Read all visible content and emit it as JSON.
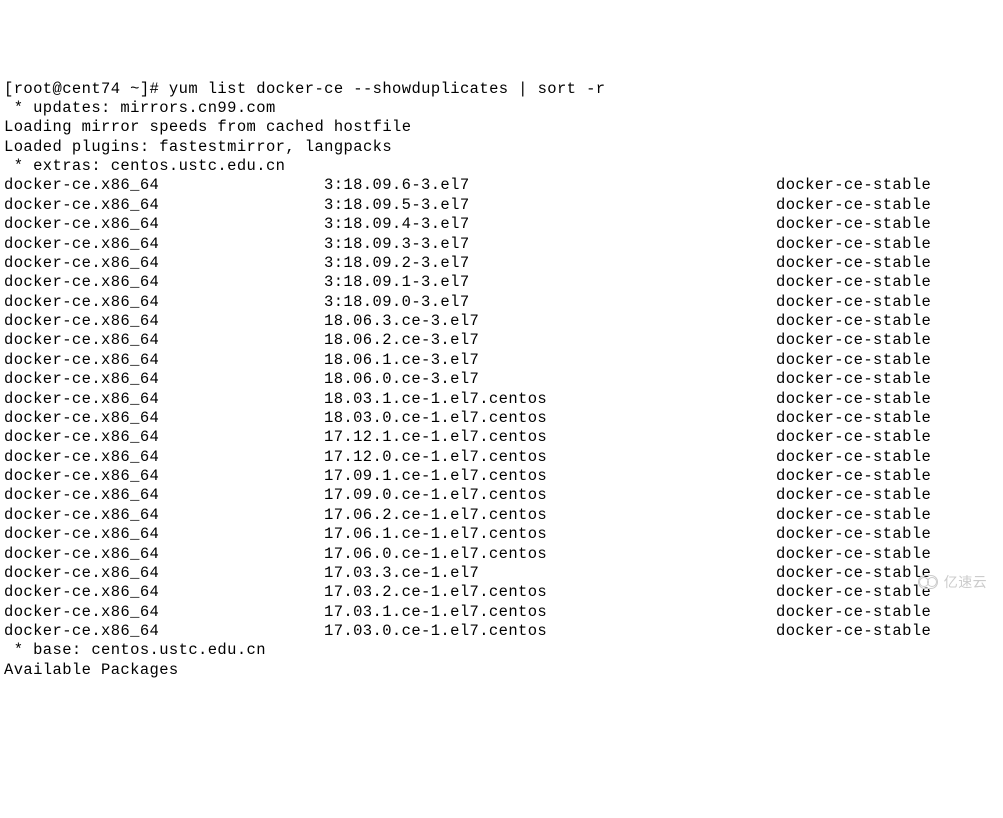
{
  "prompt": "[root@cent74 ~]# yum list docker-ce --showduplicates | sort -r",
  "header_lines": [
    " * updates: mirrors.cn99.com",
    "Loading mirror speeds from cached hostfile",
    "Loaded plugins: fastestmirror, langpacks",
    " * extras: centos.ustc.edu.cn"
  ],
  "packages": [
    {
      "name": "docker-ce.x86_64",
      "version": "3:18.09.6-3.el7",
      "repo": "docker-ce-stable"
    },
    {
      "name": "docker-ce.x86_64",
      "version": "3:18.09.5-3.el7",
      "repo": "docker-ce-stable"
    },
    {
      "name": "docker-ce.x86_64",
      "version": "3:18.09.4-3.el7",
      "repo": "docker-ce-stable"
    },
    {
      "name": "docker-ce.x86_64",
      "version": "3:18.09.3-3.el7",
      "repo": "docker-ce-stable"
    },
    {
      "name": "docker-ce.x86_64",
      "version": "3:18.09.2-3.el7",
      "repo": "docker-ce-stable"
    },
    {
      "name": "docker-ce.x86_64",
      "version": "3:18.09.1-3.el7",
      "repo": "docker-ce-stable"
    },
    {
      "name": "docker-ce.x86_64",
      "version": "3:18.09.0-3.el7",
      "repo": "docker-ce-stable"
    },
    {
      "name": "docker-ce.x86_64",
      "version": "18.06.3.ce-3.el7",
      "repo": "docker-ce-stable"
    },
    {
      "name": "docker-ce.x86_64",
      "version": "18.06.2.ce-3.el7",
      "repo": "docker-ce-stable"
    },
    {
      "name": "docker-ce.x86_64",
      "version": "18.06.1.ce-3.el7",
      "repo": "docker-ce-stable"
    },
    {
      "name": "docker-ce.x86_64",
      "version": "18.06.0.ce-3.el7",
      "repo": "docker-ce-stable"
    },
    {
      "name": "docker-ce.x86_64",
      "version": "18.03.1.ce-1.el7.centos",
      "repo": "docker-ce-stable"
    },
    {
      "name": "docker-ce.x86_64",
      "version": "18.03.0.ce-1.el7.centos",
      "repo": "docker-ce-stable"
    },
    {
      "name": "docker-ce.x86_64",
      "version": "17.12.1.ce-1.el7.centos",
      "repo": "docker-ce-stable"
    },
    {
      "name": "docker-ce.x86_64",
      "version": "17.12.0.ce-1.el7.centos",
      "repo": "docker-ce-stable"
    },
    {
      "name": "docker-ce.x86_64",
      "version": "17.09.1.ce-1.el7.centos",
      "repo": "docker-ce-stable"
    },
    {
      "name": "docker-ce.x86_64",
      "version": "17.09.0.ce-1.el7.centos",
      "repo": "docker-ce-stable"
    },
    {
      "name": "docker-ce.x86_64",
      "version": "17.06.2.ce-1.el7.centos",
      "repo": "docker-ce-stable"
    },
    {
      "name": "docker-ce.x86_64",
      "version": "17.06.1.ce-1.el7.centos",
      "repo": "docker-ce-stable"
    },
    {
      "name": "docker-ce.x86_64",
      "version": "17.06.0.ce-1.el7.centos",
      "repo": "docker-ce-stable"
    },
    {
      "name": "docker-ce.x86_64",
      "version": "17.03.3.ce-1.el7",
      "repo": "docker-ce-stable"
    },
    {
      "name": "docker-ce.x86_64",
      "version": "17.03.2.ce-1.el7.centos",
      "repo": "docker-ce-stable"
    },
    {
      "name": "docker-ce.x86_64",
      "version": "17.03.1.ce-1.el7.centos",
      "repo": "docker-ce-stable"
    },
    {
      "name": "docker-ce.x86_64",
      "version": "17.03.0.ce-1.el7.centos",
      "repo": "docker-ce-stable"
    }
  ],
  "footer_lines": [
    " * base: centos.ustc.edu.cn",
    "Available Packages"
  ],
  "watermark_text": "亿速云"
}
